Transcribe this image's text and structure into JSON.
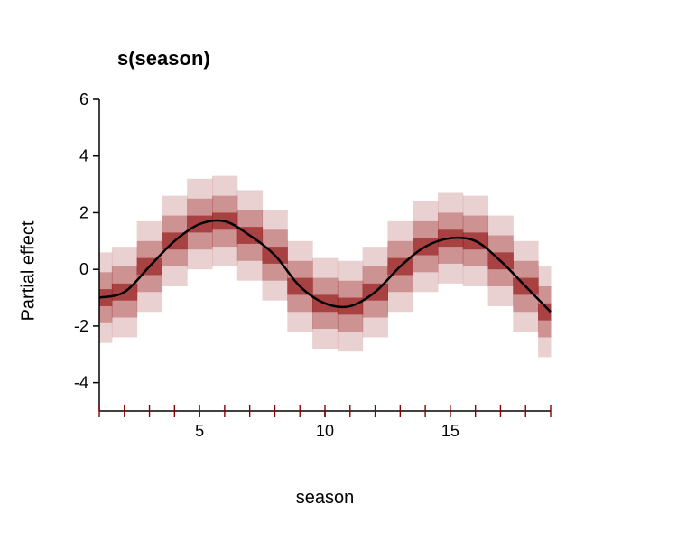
{
  "chart_data": {
    "type": "line",
    "title": "s(season)",
    "xlabel": "season",
    "ylabel": "Partial effect",
    "xlim": [
      1,
      19
    ],
    "ylim": [
      -5,
      6
    ],
    "x_ticks": [
      5,
      10,
      15
    ],
    "y_ticks": [
      -4,
      -2,
      0,
      2,
      4,
      6
    ],
    "rug_x": [
      1,
      2,
      3,
      4,
      5,
      6,
      7,
      8,
      9,
      10,
      11,
      12,
      13,
      14,
      15,
      16,
      17,
      18,
      19
    ],
    "x": [
      1,
      2,
      3,
      4,
      5,
      6,
      7,
      8,
      9,
      10,
      11,
      12,
      13,
      14,
      15,
      16,
      17,
      18,
      19
    ],
    "mean": [
      -1.0,
      -0.8,
      0.1,
      1.0,
      1.6,
      1.7,
      1.2,
      0.5,
      -0.6,
      -1.2,
      -1.3,
      -0.8,
      0.1,
      0.8,
      1.1,
      1.0,
      0.3,
      -0.6,
      -1.5
    ],
    "bands": [
      {
        "name": "ci_inner",
        "color": "rgba(139,0,0,0.55)",
        "lo": [
          -1.3,
          -1.1,
          -0.2,
          0.7,
          1.3,
          1.4,
          0.9,
          0.2,
          -0.9,
          -1.5,
          -1.6,
          -1.1,
          -0.2,
          0.5,
          0.8,
          0.7,
          0.0,
          -0.9,
          -1.8
        ],
        "hi": [
          -0.7,
          -0.5,
          0.4,
          1.3,
          1.9,
          2.0,
          1.5,
          0.8,
          -0.3,
          -0.9,
          -1.0,
          -0.5,
          0.4,
          1.1,
          1.4,
          1.3,
          0.6,
          -0.3,
          -1.2
        ]
      },
      {
        "name": "ci_mid",
        "color": "rgba(139,0,0,0.30)",
        "lo": [
          -1.9,
          -1.7,
          -0.8,
          0.1,
          0.7,
          0.8,
          0.3,
          -0.4,
          -1.5,
          -2.1,
          -2.2,
          -1.7,
          -0.8,
          -0.1,
          0.2,
          0.1,
          -0.6,
          -1.5,
          -2.4
        ],
        "hi": [
          -0.1,
          0.1,
          1.0,
          1.9,
          2.5,
          2.6,
          2.1,
          1.4,
          0.3,
          -0.3,
          -0.4,
          0.1,
          1.0,
          1.7,
          2.0,
          1.9,
          1.2,
          0.3,
          -0.6
        ]
      },
      {
        "name": "ci_outer",
        "color": "rgba(139,0,0,0.18)",
        "lo": [
          -2.6,
          -2.4,
          -1.5,
          -0.6,
          0.0,
          0.1,
          -0.4,
          -1.1,
          -2.2,
          -2.8,
          -2.9,
          -2.4,
          -1.5,
          -0.8,
          -0.5,
          -0.6,
          -1.3,
          -2.2,
          -3.1
        ],
        "hi": [
          0.6,
          0.8,
          1.7,
          2.6,
          3.2,
          3.3,
          2.8,
          2.1,
          1.0,
          0.4,
          0.3,
          0.8,
          1.7,
          2.4,
          2.7,
          2.6,
          1.9,
          1.0,
          0.1
        ]
      }
    ]
  },
  "labels": {
    "title": "s(season)",
    "xlabel": "season",
    "ylabel": "Partial effect"
  }
}
